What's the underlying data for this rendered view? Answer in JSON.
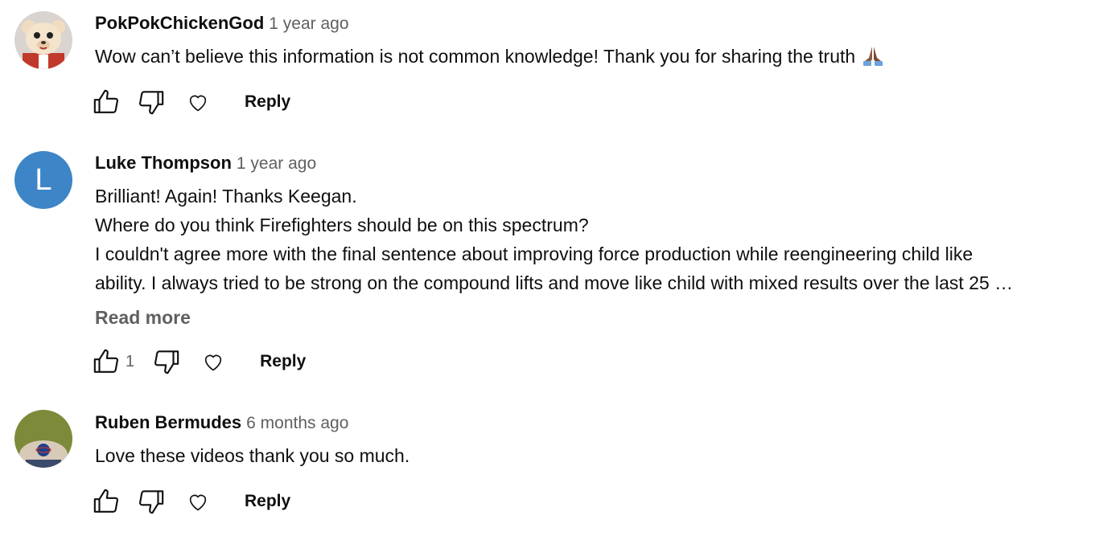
{
  "comments": [
    {
      "author": "PokPokChickenGod",
      "time": "1 year ago",
      "lines": [
        "Wow can’t believe this information is not common knowledge! Thank you for sharing the truth"
      ],
      "emoji": "folded-hands",
      "likes": "",
      "reply_label": "Reply",
      "avatar": "cartoon-bear"
    },
    {
      "author": "Luke Thompson",
      "time": "1 year ago",
      "lines": [
        "Brilliant! Again! Thanks Keegan.",
        "Where do you think Firefighters should be on this spectrum?",
        "I couldn't agree more with the final sentence about improving force production while reengineering child like",
        "ability.  I always tried to be strong on the compound lifts and move like child with mixed results over the last 25 …"
      ],
      "read_more": "Read more",
      "likes": "1",
      "reply_label": "Reply",
      "avatar_letter": "L",
      "avatar_color": "#3d85c6"
    },
    {
      "author": "Ruben Bermudes",
      "time": "6 months ago",
      "lines": [
        "Love these videos thank you so much."
      ],
      "likes": "",
      "reply_label": "Reply",
      "avatar": "photo-with-badge"
    }
  ],
  "colors": {
    "primary_text": "#0f0f0f",
    "secondary_text": "#606060"
  }
}
